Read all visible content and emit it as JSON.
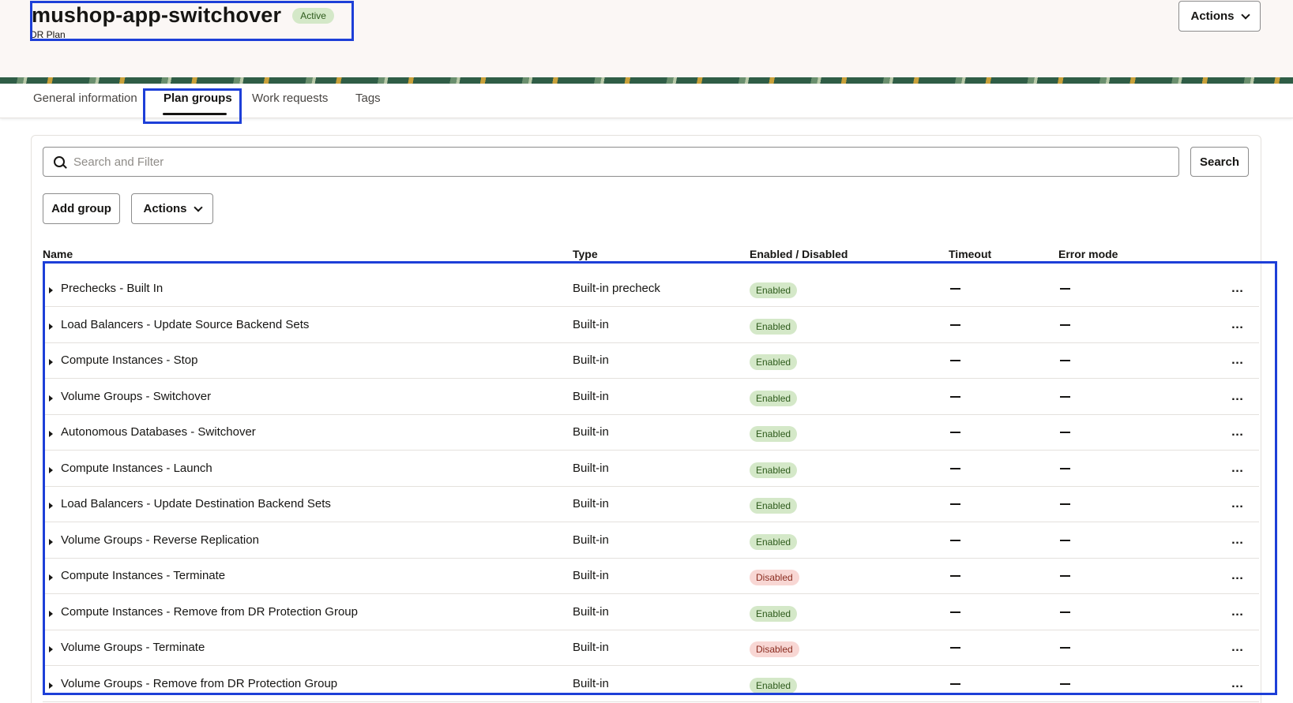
{
  "header": {
    "title": "mushop-app-switchover",
    "status_badge": "Active",
    "subtitle": "DR Plan",
    "actions_label": "Actions"
  },
  "tabs": [
    {
      "label": "General information"
    },
    {
      "label": "Plan groups"
    },
    {
      "label": "Work requests"
    },
    {
      "label": "Tags"
    }
  ],
  "active_tab": "Plan groups",
  "search": {
    "placeholder": "Search and Filter",
    "value": "",
    "button_label": "Search"
  },
  "toolbar": {
    "add_label": "Add group",
    "actions_label": "Actions"
  },
  "table": {
    "columns": [
      "Name",
      "Type",
      "Enabled / Disabled",
      "Timeout",
      "Error mode"
    ],
    "rows": [
      {
        "name": "Prechecks - Built In",
        "type": "Built-in precheck",
        "status": "Enabled"
      },
      {
        "name": "Load Balancers - Update Source Backend Sets",
        "type": "Built-in",
        "status": "Enabled"
      },
      {
        "name": "Compute Instances - Stop",
        "type": "Built-in",
        "status": "Enabled"
      },
      {
        "name": "Volume Groups - Switchover",
        "type": "Built-in",
        "status": "Enabled"
      },
      {
        "name": "Autonomous Databases - Switchover",
        "type": "Built-in",
        "status": "Enabled"
      },
      {
        "name": "Compute Instances - Launch",
        "type": "Built-in",
        "status": "Enabled"
      },
      {
        "name": "Load Balancers - Update Destination Backend Sets",
        "type": "Built-in",
        "status": "Enabled"
      },
      {
        "name": "Volume Groups - Reverse Replication",
        "type": "Built-in",
        "status": "Enabled"
      },
      {
        "name": "Compute Instances - Terminate",
        "type": "Built-in",
        "status": "Disabled"
      },
      {
        "name": "Compute Instances - Remove from DR Protection Group",
        "type": "Built-in",
        "status": "Enabled"
      },
      {
        "name": "Volume Groups - Terminate",
        "type": "Built-in",
        "status": "Disabled"
      },
      {
        "name": "Volume Groups - Remove from DR Protection Group",
        "type": "Built-in",
        "status": "Enabled"
      }
    ]
  },
  "colors": {
    "accent_highlight": "#1d3fd8",
    "enabled_badge": "#d4e8c8",
    "disabled_badge": "#f8d7d4"
  },
  "icons": {
    "search": "search-icon",
    "row_expand": "caret-right-icon",
    "row_menu": "more-actions-icon",
    "dropdown": "chevron-down-icon"
  }
}
